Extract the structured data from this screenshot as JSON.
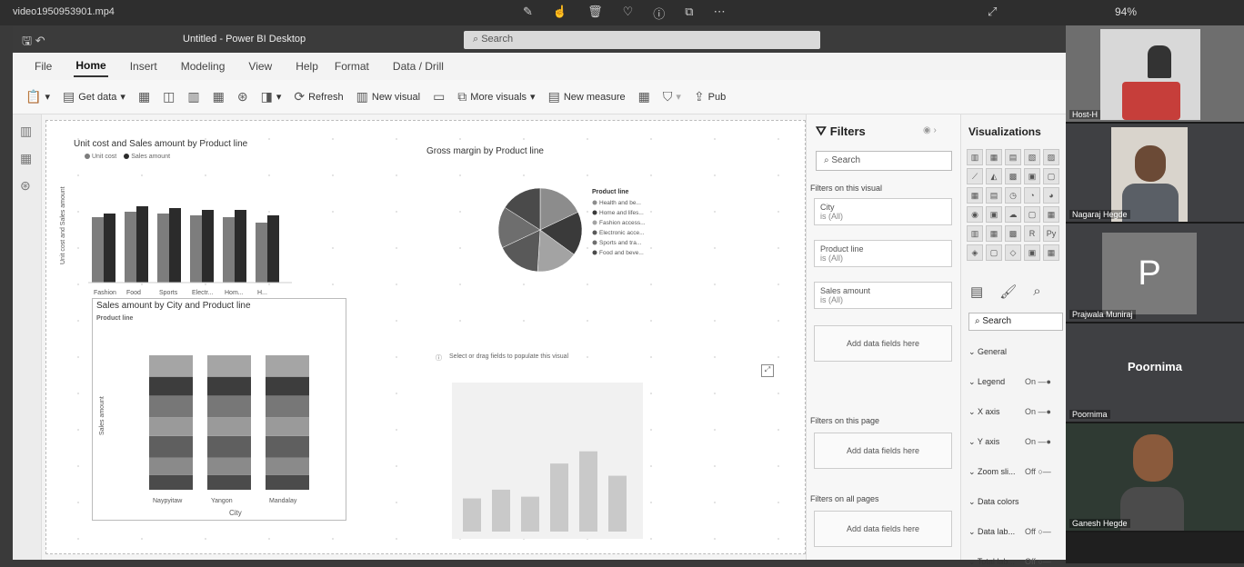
{
  "recording": {
    "filename": "video1950953901.mp4",
    "battery": "94%"
  },
  "window": {
    "title": "Untitled - Power BI Desktop",
    "search_placeholder": "Search"
  },
  "tabs": [
    {
      "label": "File"
    },
    {
      "label": "Home"
    },
    {
      "label": "Insert"
    },
    {
      "label": "Modeling"
    },
    {
      "label": "View"
    },
    {
      "label": "Help"
    },
    {
      "label": "Format"
    },
    {
      "label": "Data / Drill"
    }
  ],
  "ribbon": {
    "get_data": "Get data",
    "refresh": "Refresh",
    "new_visual": "New visual",
    "more_visuals": "More visuals",
    "new_measure": "New measure",
    "publish": "Pub"
  },
  "visuals": {
    "chart1_title": "Unit cost and Sales amount by Product line",
    "chart1_legend": [
      "Unit cost",
      "Sales amount"
    ],
    "chart1_ylabel": "Unit cost and Sales amount",
    "chart2_title": "Gross margin by Product line",
    "chart2_legend_title": "Product line",
    "chart2_legend": [
      "Health and be...",
      "Home and lifes...",
      "Fashion access...",
      "Electronic acce...",
      "Sports and tra...",
      "Food and beve..."
    ],
    "chart3_title": "Sales amount by City and Product line",
    "chart3_legend_label": "Product line",
    "chart3_ylabel": "Sales amount",
    "chart3_xlabel": "City",
    "chart4_hint": "Select or drag fields to populate this visual"
  },
  "chart_data": [
    {
      "type": "bar",
      "categories": [
        "Fashion",
        "Food",
        "Sports",
        "Electr...",
        "Hom...",
        "H..."
      ],
      "series": [
        {
          "name": "Unit cost"
        },
        {
          "name": "Sales amount"
        }
      ]
    },
    {
      "type": "pie",
      "categories": [
        "Health and be...",
        "Home and lifes...",
        "Fashion access...",
        "Electronic acce...",
        "Sports and tra...",
        "Food and beve..."
      ]
    },
    {
      "type": "bar",
      "categories": [
        "Naypyitaw",
        "Yangon",
        "Mandalay"
      ]
    },
    {
      "type": "bar",
      "values": [
        38,
        48,
        40,
        78,
        92,
        64
      ]
    }
  ],
  "filters": {
    "title": "Filters",
    "search": "Search",
    "on_visual": "Filters on this visual",
    "cards": [
      {
        "field": "City",
        "value": "is (All)"
      },
      {
        "field": "Product line",
        "value": "is (All)"
      },
      {
        "field": "Sales amount",
        "value": "is (All)"
      }
    ],
    "add_fields": "Add data fields here",
    "on_page": "Filters on this page",
    "on_all_pages": "Filters on all pages"
  },
  "visualizations": {
    "title": "Visualizations",
    "search": "Search",
    "props": [
      {
        "name": "General",
        "state": ""
      },
      {
        "name": "Legend",
        "state": "On"
      },
      {
        "name": "X axis",
        "state": "On"
      },
      {
        "name": "Y axis",
        "state": "On"
      },
      {
        "name": "Zoom sli...",
        "state": "Off"
      },
      {
        "name": "Data colors",
        "state": ""
      },
      {
        "name": "Data lab...",
        "state": "Off"
      },
      {
        "name": "Total lab...",
        "state": "Off"
      }
    ]
  },
  "participants": [
    {
      "name": "Host-H"
    },
    {
      "name": "Nagaraj Hegde"
    },
    {
      "name": "Prajwala Muniraj",
      "initial": "P"
    },
    {
      "name": "Poornima"
    },
    {
      "name": "Ganesh Hegde"
    }
  ]
}
